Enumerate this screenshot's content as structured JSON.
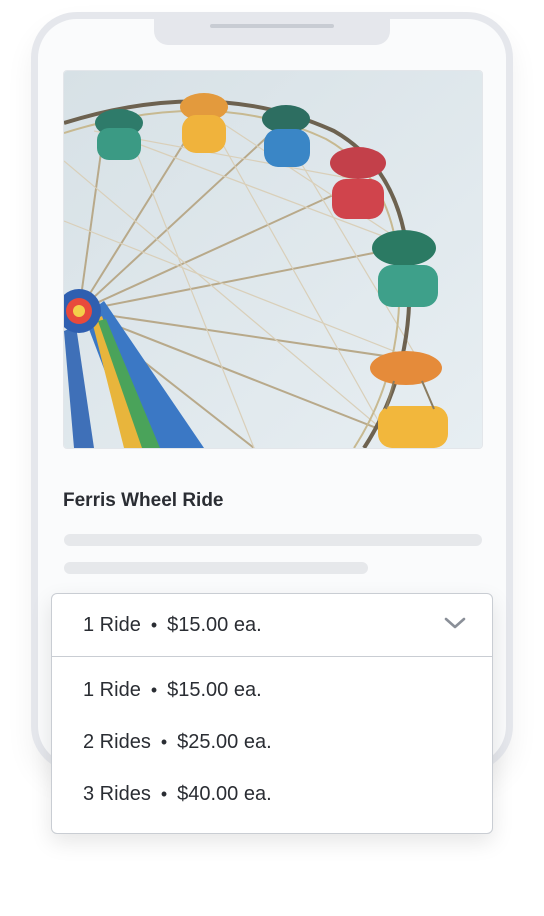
{
  "product": {
    "title": "Ferris Wheel Ride",
    "image_icon": "ferris-wheel-photo"
  },
  "dropdown": {
    "selected": {
      "quantity": "1 Ride",
      "separator": "•",
      "price": "$15.00 ea."
    },
    "options": [
      {
        "quantity": "1 Ride",
        "separator": "•",
        "price": "$15.00 ea."
      },
      {
        "quantity": "2 Rides",
        "separator": "•",
        "price": "$25.00 ea."
      },
      {
        "quantity": "3 Rides",
        "separator": "•",
        "price": "$40.00 ea."
      }
    ],
    "chevron_icon": "chevron-down-icon"
  },
  "colors": {
    "frame": "#e5e7ec",
    "text": "#2a2d33",
    "skeleton": "#e6e8eb",
    "border": "#c9cdd3",
    "sky": "#dfe8ee"
  }
}
